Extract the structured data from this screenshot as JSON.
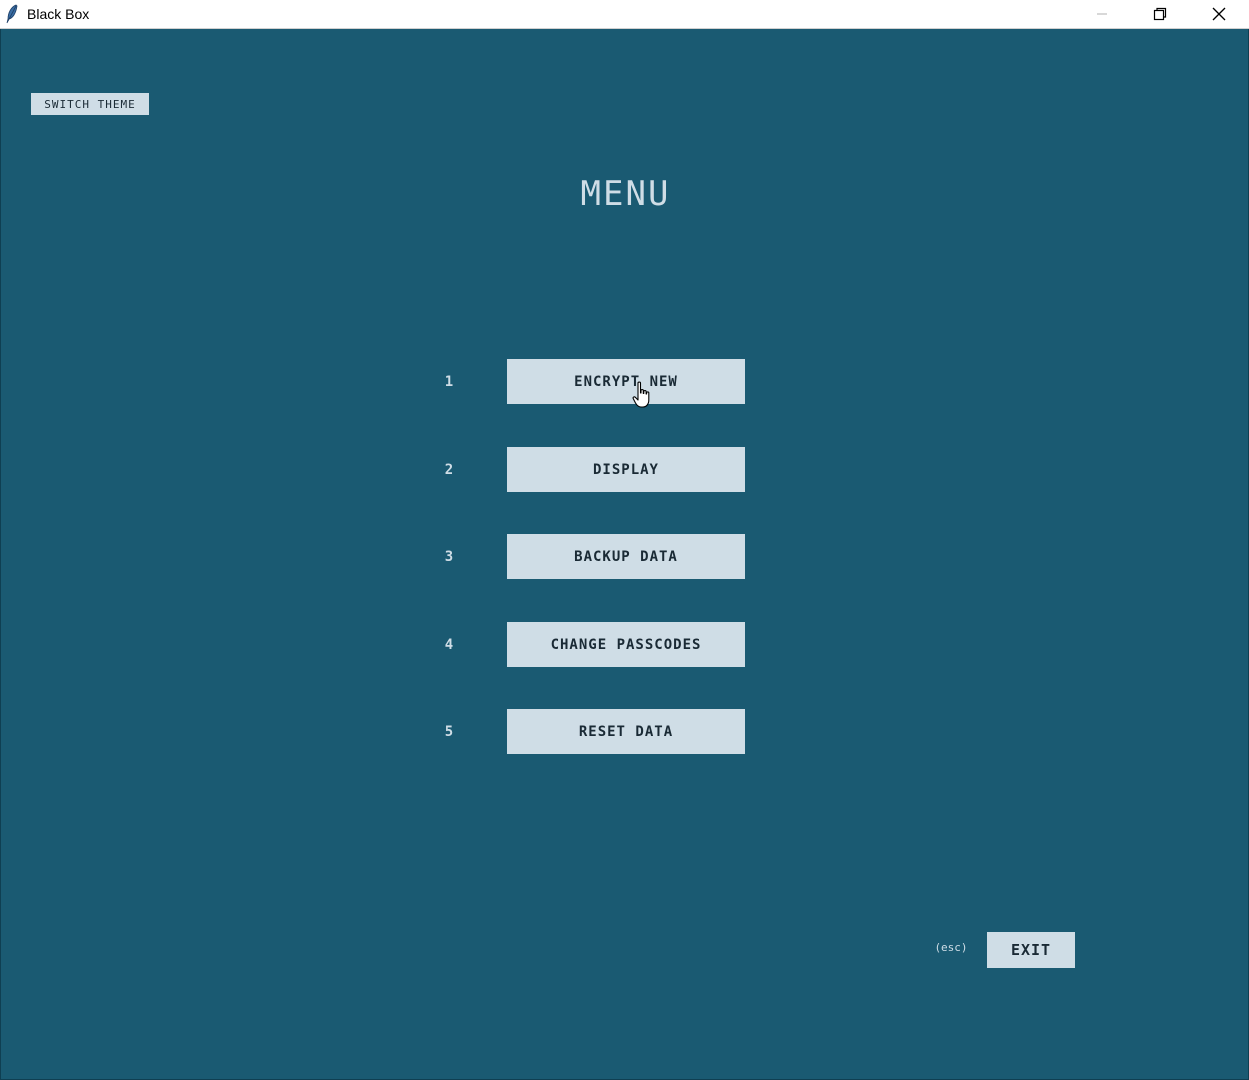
{
  "window": {
    "title": "Black Box"
  },
  "toolbar": {
    "switch_theme_label": "SWITCH THEME"
  },
  "menu": {
    "title": "MENU",
    "items": [
      {
        "number": "1",
        "label": "ENCRYPT NEW"
      },
      {
        "number": "2",
        "label": "DISPLAY"
      },
      {
        "number": "3",
        "label": "BACKUP DATA"
      },
      {
        "number": "4",
        "label": "CHANGE PASSCODES"
      },
      {
        "number": "5",
        "label": "RESET DATA"
      }
    ]
  },
  "exit": {
    "hint": "(esc)",
    "label": "EXIT"
  },
  "colors": {
    "background": "#1a5a72",
    "button": "#cfdde6",
    "button_text": "#1a2a35",
    "foreground_text": "#cfdde6"
  },
  "icons": {
    "app": "feather-icon",
    "minimize": "minimize-icon",
    "restore": "restore-icon",
    "close": "close-icon",
    "cursor": "hand-pointer-icon"
  }
}
